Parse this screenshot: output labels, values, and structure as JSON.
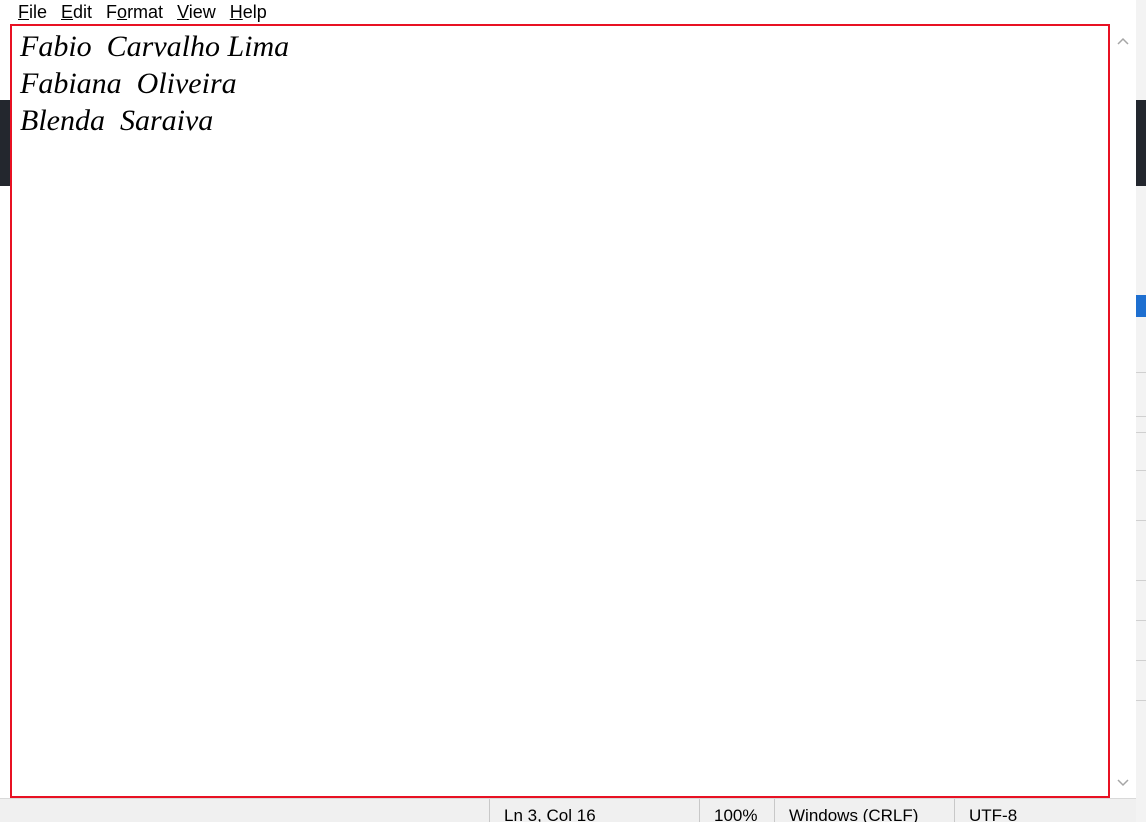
{
  "menu": {
    "file": {
      "mnemonic": "F",
      "rest": "ile"
    },
    "edit": {
      "mnemonic": "E",
      "rest": "dit"
    },
    "format": {
      "pre": "F",
      "mnemonic": "o",
      "rest": "rmat"
    },
    "view": {
      "mnemonic": "V",
      "rest": "iew"
    },
    "help": {
      "mnemonic": "H",
      "rest": "elp"
    }
  },
  "document": {
    "lines": [
      "Fabio  Carvalho Lima",
      "Fabiana  Oliveira",
      "Blenda  Saraiva"
    ]
  },
  "status": {
    "position": "Ln 3, Col 16",
    "zoom": "100%",
    "line_ending": "Windows (CRLF)",
    "encoding": "UTF-8"
  },
  "colors": {
    "highlight_border": "#e81123",
    "status_bg": "#f0f0f0"
  },
  "icons": {
    "scroll_up": "chevron-up-icon",
    "scroll_down": "chevron-down-icon"
  }
}
